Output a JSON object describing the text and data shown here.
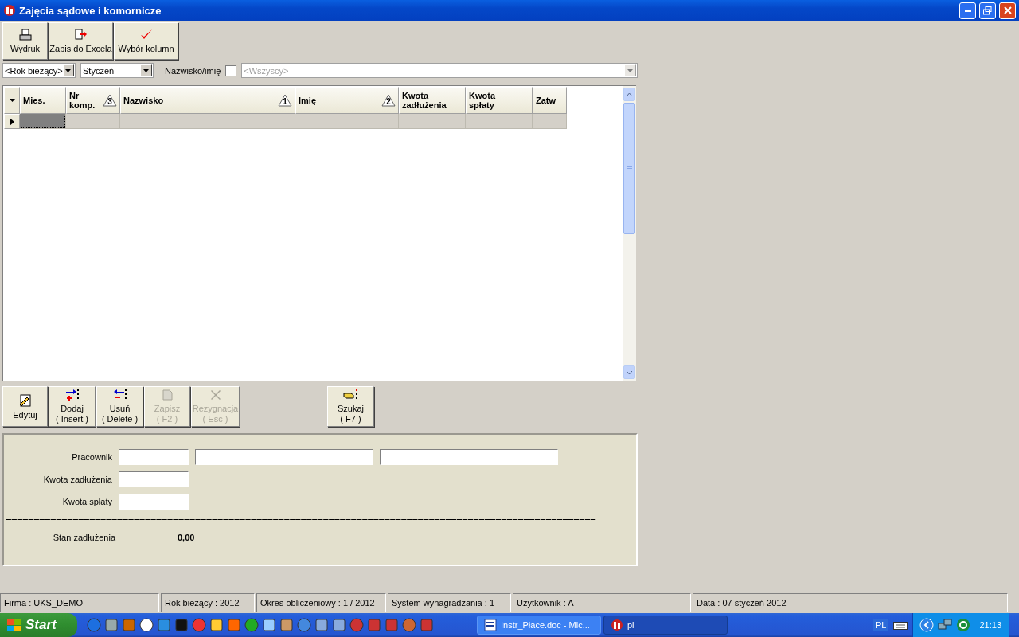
{
  "window": {
    "title": "Zajęcia sądowe i komornicze"
  },
  "toolbar": [
    {
      "label": "Wydruk"
    },
    {
      "label": "Zapis do Excela"
    },
    {
      "label": "Wybór kolumn"
    }
  ],
  "filters": {
    "year": "<Rok bieżący>",
    "month": "Styczeń",
    "name_filter": {
      "label": "Nazwisko/imię",
      "checked": false
    },
    "employee": {
      "value": "<Wszyscy>",
      "disabled": true
    }
  },
  "grid": {
    "columns": [
      {
        "label": "Mies."
      },
      {
        "label": "Nr komp.",
        "sort": "3"
      },
      {
        "label": "Nazwisko",
        "sort": "1"
      },
      {
        "label": "Imię",
        "sort": "2"
      },
      {
        "label": "Kwota zadłużenia"
      },
      {
        "label": "Kwota spłaty"
      },
      {
        "label": "Zatw"
      }
    ],
    "rows": [
      {
        "selected": true
      }
    ]
  },
  "actions": [
    {
      "label": "Edytuj",
      "disabled": false
    },
    {
      "label": "Dodaj",
      "hint": "( Insert )",
      "disabled": false
    },
    {
      "label": "Usuń",
      "hint": "( Delete )",
      "disabled": false
    },
    {
      "label": "Zapisz",
      "hint": "( F2 )",
      "disabled": true
    },
    {
      "label": "Rezygnacja",
      "hint": "( Esc )",
      "disabled": true
    },
    {
      "label": "Szukaj",
      "hint": "( F7 )",
      "disabled": false
    }
  ],
  "form": {
    "rows": [
      {
        "label": "Pracownik",
        "inputs": [
          {
            "kind": "short"
          },
          {
            "kind": "wide"
          },
          {
            "kind": "wide"
          }
        ]
      },
      {
        "label": "Kwota zadłużenia",
        "inputs": [
          {
            "kind": "short"
          }
        ]
      },
      {
        "label": "Kwota spłaty",
        "inputs": [
          {
            "kind": "short"
          }
        ]
      }
    ],
    "separator": "==========================================================================================================",
    "balance": {
      "label": "Stan zadłużenia",
      "value": "0,00"
    }
  },
  "status_bar": [
    "Firma : UKS_DEMO",
    "Rok bieżący : 2012",
    "Okres obliczeniowy : 1 / 2012",
    "System wynagradzania : 1",
    "Użytkownik : A",
    "Data : 07 styczeń 2012"
  ],
  "taskbar": {
    "start": "Start",
    "tasks": [
      {
        "label": "Instr_Płace.doc - Mic...",
        "selected": false
      },
      {
        "label": "pl",
        "selected": true
      }
    ],
    "language": "PL",
    "clock": "21:13"
  }
}
